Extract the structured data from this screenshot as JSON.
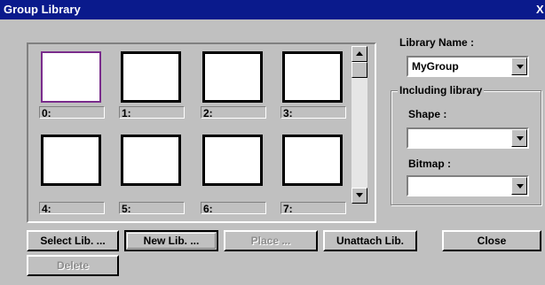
{
  "window": {
    "title": "Group Library",
    "close_glyph": "X"
  },
  "cells": [
    {
      "label": "0:"
    },
    {
      "label": "1:"
    },
    {
      "label": "2:"
    },
    {
      "label": "3:"
    },
    {
      "label": "4:"
    },
    {
      "label": "5:"
    },
    {
      "label": "6:"
    },
    {
      "label": "7:"
    }
  ],
  "library": {
    "name_label": "Library  Name :",
    "name_value": "MyGroup"
  },
  "including": {
    "group_label": "Including library",
    "shape_label": "Shape :",
    "shape_value": "",
    "bitmap_label": "Bitmap :",
    "bitmap_value": ""
  },
  "buttons": {
    "select": "Select Lib. ...",
    "new": "New Lib. ...",
    "place": "Place ...",
    "unattach": "Unattach Lib.",
    "close": "Close",
    "delete": "Delete"
  }
}
